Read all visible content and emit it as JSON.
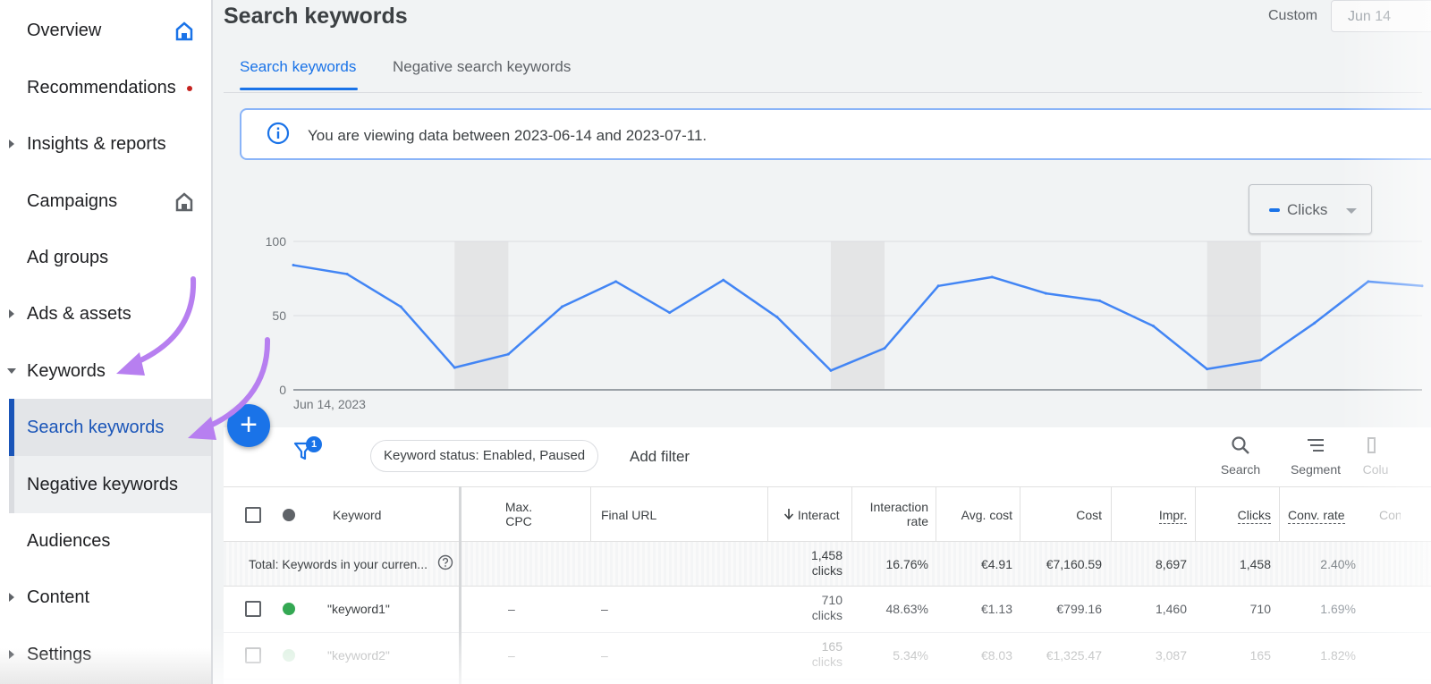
{
  "sidebar": {
    "items": [
      {
        "label": "Overview"
      },
      {
        "label": "Recommendations"
      },
      {
        "label": "Insights & reports"
      },
      {
        "label": "Campaigns"
      },
      {
        "label": "Ad groups"
      },
      {
        "label": "Ads & assets"
      },
      {
        "label": "Keywords"
      },
      {
        "label": "Search keywords"
      },
      {
        "label": "Negative keywords"
      },
      {
        "label": "Audiences"
      },
      {
        "label": "Content"
      },
      {
        "label": "Settings"
      }
    ]
  },
  "header": {
    "title": "Search keywords",
    "date_range_label": "Custom",
    "date_range_value": "Jun 14"
  },
  "tabs": [
    {
      "label": "Search keywords"
    },
    {
      "label": "Negative search keywords"
    }
  ],
  "banner": {
    "text": "You are viewing data between 2023-06-14 and 2023-07-11."
  },
  "chart_data": {
    "type": "line",
    "metric": "Clicks",
    "y_ticks": [
      "100",
      "50",
      "0"
    ],
    "ylim": [
      0,
      100
    ],
    "x_start_label": "Jun 14, 2023",
    "series": [
      {
        "values": [
          84,
          78,
          56,
          15,
          24,
          56,
          73,
          52,
          74,
          49,
          13,
          28,
          70,
          76,
          65,
          60,
          43,
          14,
          20,
          45,
          73,
          70
        ]
      }
    ],
    "shaded_bands": [
      [
        3,
        4
      ],
      [
        10,
        11
      ],
      [
        17,
        18
      ]
    ],
    "color": "#4285f4"
  },
  "toolbar": {
    "add_button": "+",
    "filter_count": "1",
    "filter_chip": "Keyword status: Enabled, Paused",
    "add_filter": "Add filter",
    "search_label": "Search",
    "segment_label": "Segment",
    "columns_label": "Colu"
  },
  "table": {
    "headers": {
      "keyword": "Keyword",
      "max_cpc_1": "Max.",
      "max_cpc_2": "CPC",
      "final_url": "Final URL",
      "interactions": "Interact",
      "interaction_rate_1": "Interaction",
      "interaction_rate_2": "rate",
      "avg_cost": "Avg. cost",
      "cost": "Cost",
      "impr": "Impr.",
      "clicks": "Clicks",
      "conv_rate": "Conv. rate",
      "conv": "Con"
    },
    "total": {
      "label": "Total: Keywords in your curren...",
      "interactions_1": "1,458",
      "interactions_2": "clicks",
      "interaction_rate": "16.76%",
      "avg_cost": "€4.91",
      "cost": "€7,160.59",
      "impr": "8,697",
      "clicks": "1,458",
      "conv_rate": "2.40%"
    },
    "rows": [
      {
        "keyword": "\"keyword1\"",
        "status_color": "#34a853",
        "max_cpc": "–",
        "final_url": "–",
        "interactions_1": "710",
        "interactions_2": "clicks",
        "interaction_rate": "48.63%",
        "avg_cost": "€1.13",
        "cost": "€799.16",
        "impr": "1,460",
        "clicks": "710",
        "conv_rate": "1.69%"
      },
      {
        "keyword": "\"keyword2\"",
        "status_color": "#a8dab5",
        "max_cpc": "–",
        "final_url": "–",
        "interactions_1": "165",
        "interactions_2": "clicks",
        "interaction_rate": "5.34%",
        "avg_cost": "€8.03",
        "cost": "€1,325.47",
        "impr": "3,087",
        "clicks": "165",
        "conv_rate": "1.82%"
      }
    ]
  },
  "colors": {
    "accent": "#1a73e8",
    "active_nav": "#1a55b8",
    "annotation_arrow": "#b77ff0"
  }
}
